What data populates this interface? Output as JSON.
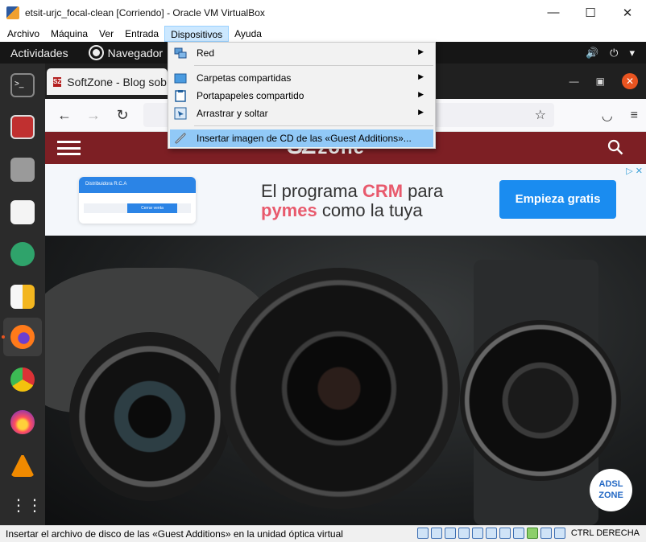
{
  "window": {
    "title": "etsit-urjc_focal-clean [Corriendo] - Oracle VM VirtualBox",
    "minimize": "—",
    "maximize": "☐",
    "close": "✕"
  },
  "menubar": {
    "items": [
      {
        "label": "Archivo"
      },
      {
        "label": "Máquina"
      },
      {
        "label": "Ver"
      },
      {
        "label": "Entrada"
      },
      {
        "label": "Dispositivos"
      },
      {
        "label": "Ayuda"
      }
    ]
  },
  "dropdown": {
    "items": [
      {
        "label": "Red",
        "icon": "network-icon",
        "submenu": true
      },
      {
        "label": "Carpetas compartidas",
        "icon": "folder-icon",
        "submenu": true
      },
      {
        "label": "Portapapeles compartido",
        "icon": "clipboard-icon",
        "submenu": true
      },
      {
        "label": "Arrastrar y soltar",
        "icon": "drag-drop-icon",
        "submenu": true
      },
      {
        "label": "Insertar imagen de CD de las «Guest Additions»...",
        "icon": "cd-icon",
        "submenu": false
      }
    ]
  },
  "guest_topbar": {
    "activities": "Actividades",
    "app_name": "Navegador"
  },
  "firefox": {
    "tab_title": "SoftZone - Blog sobre software",
    "favicon_text": "SZ"
  },
  "site": {
    "logo_text": "zone",
    "logo_mark": "SZ"
  },
  "ad": {
    "mock_title": "Distribuidora R.C.A",
    "mock_button": "Cerrar venta",
    "line1_pre": "El programa ",
    "line1_hl": "CRM",
    "line1_post": " para",
    "line2_hl": "pymes",
    "line2_post": " como la tuya",
    "cta": "Empieza gratis",
    "adchoice": "▷ ✕"
  },
  "statusbar": {
    "message": "Insertar el archivo de disco de las «Guest Additions» en la unidad óptica virtual",
    "host_key": "CTRL DERECHA"
  },
  "colors": {
    "menu_highlight": "#cce8ff",
    "dropdown_hover": "#91c9f7",
    "site_header": "#7d1f24",
    "ubuntu_orange": "#e95420",
    "ad_cta": "#1a8cf0"
  }
}
